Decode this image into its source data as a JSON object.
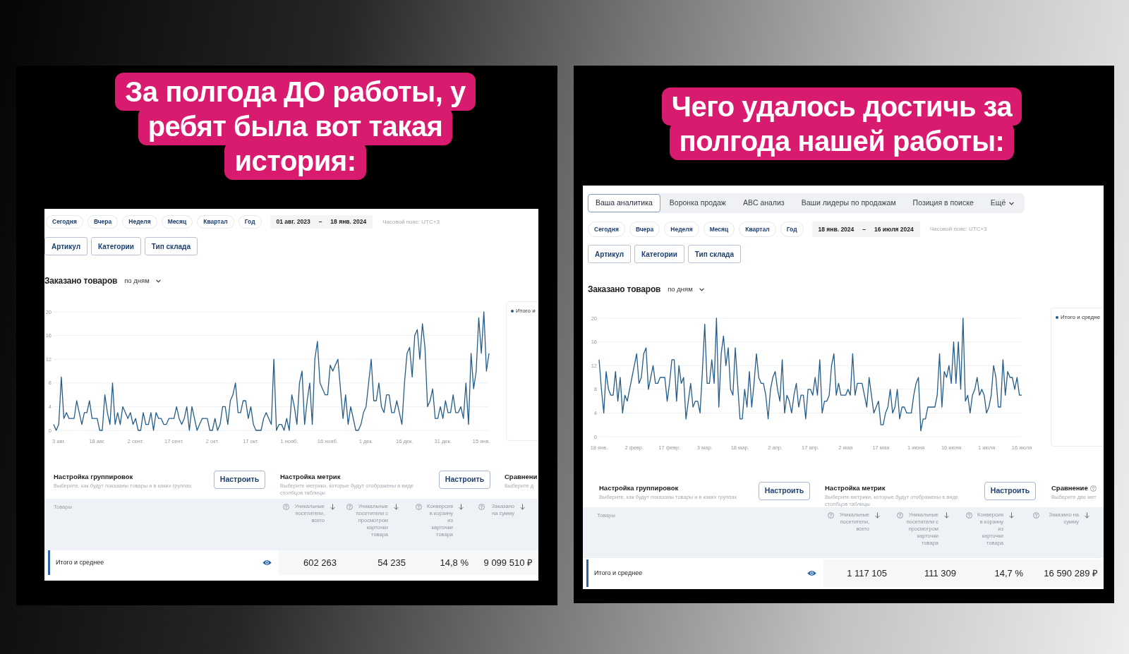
{
  "panels": [
    {
      "headline": "За полгода ДО работы, у ребят была вот такая история:",
      "screenshot": {
        "periods": [
          {
            "label": "Сегодня",
            "selected": false
          },
          {
            "label": "Вчера",
            "selected": false
          },
          {
            "label": "Неделя",
            "selected": false
          },
          {
            "label": "Месяц",
            "selected": false
          },
          {
            "label": "Квартал",
            "selected": false
          },
          {
            "label": "Год",
            "selected": false
          }
        ],
        "date_range": {
          "from": "01 авг. 2023",
          "separator": "–",
          "to": "18 янв. 2024"
        },
        "timezone": "Часовой пояс: UTC+3",
        "filters": [
          "Артикул",
          "Категории",
          "Тип склада"
        ],
        "chart_title": "Заказано товаров",
        "granularity": "по дням",
        "chart_data": {
          "type": "line",
          "categories": [
            null,
            null,
            "3 авг.",
            null,
            null,
            null,
            null,
            null,
            null,
            null,
            null,
            null,
            null,
            null,
            null,
            null,
            null,
            "18 авг.",
            null,
            null,
            null,
            null,
            null,
            null,
            null,
            null,
            null,
            null,
            null,
            null,
            null,
            null,
            "2 сент.",
            null,
            null,
            null,
            null,
            null,
            null,
            null,
            null,
            null,
            null,
            null,
            null,
            null,
            null,
            "17 сент.",
            null,
            null,
            null,
            null,
            null,
            null,
            null,
            null,
            null,
            null,
            null,
            null,
            null,
            null,
            "2 окт.",
            null,
            null,
            null,
            null,
            null,
            null,
            null,
            null,
            null,
            null,
            null,
            null,
            null,
            null,
            "17 окт.",
            null,
            null,
            null,
            null,
            null,
            null,
            null,
            null,
            null,
            null,
            null,
            null,
            null,
            null,
            "1 нояб.",
            null,
            null,
            null,
            null,
            null,
            null,
            null,
            null,
            null,
            null,
            null,
            null,
            null,
            null,
            "16 нояб.",
            null,
            null,
            null,
            null,
            null,
            null,
            null,
            null,
            null,
            null,
            null,
            null,
            null,
            null,
            "1 дек.",
            null,
            null,
            null,
            null,
            null,
            null,
            null,
            null,
            null,
            null,
            null,
            null,
            null,
            null,
            "16 дек.",
            null,
            null,
            null,
            null,
            null,
            null,
            null,
            null,
            null,
            null,
            null,
            null,
            null,
            null,
            "31 дек.",
            null,
            null,
            null,
            null,
            null,
            null,
            null,
            null,
            null,
            null,
            null,
            null,
            null,
            null,
            "15 янв.",
            null,
            null,
            null
          ],
          "series": [
            {
              "name": "Итого и",
              "color": "#255d8a",
              "values": [
                1,
                0,
                1,
                9,
                2,
                3,
                2,
                2,
                2,
                5,
                3,
                1,
                3,
                3,
                5,
                2,
                2,
                2,
                0,
                0,
                6,
                3,
                1,
                8,
                1,
                3,
                1,
                4,
                3,
                2,
                3,
                1,
                2,
                0,
                0,
                3,
                1,
                1,
                3,
                0,
                3,
                2,
                2,
                1,
                1,
                2,
                2,
                2,
                4,
                2,
                1,
                2,
                4,
                0,
                4,
                2,
                0,
                1,
                2,
                2,
                2,
                0,
                0,
                2,
                0,
                1,
                4,
                4,
                1,
                5,
                6,
                8,
                3,
                3,
                5,
                5,
                2,
                4,
                1,
                0,
                0,
                0,
                2,
                3,
                2,
                1,
                12,
                0,
                1,
                1,
                0,
                2,
                0,
                6,
                4,
                1,
                8,
                10,
                1,
                5,
                8,
                1,
                12,
                15,
                8,
                7,
                6,
                6,
                11,
                10,
                11,
                12,
                7,
                2,
                6,
                1,
                4,
                2,
                0,
                0,
                1,
                3,
                4,
                8,
                12,
                5,
                5,
                8,
                4,
                3,
                6,
                6,
                3,
                3,
                5,
                3,
                1,
                8,
                13,
                14,
                9,
                16,
                17,
                12,
                18,
                14,
                4,
                5,
                7,
                2,
                2,
                4,
                2,
                5,
                3,
                3,
                6,
                3,
                3,
                4,
                2,
                8,
                1,
                13,
                7,
                10,
                19,
                13,
                20,
                10,
                13
              ]
            }
          ],
          "ylim": [
            0,
            20
          ],
          "yticks": [
            0,
            4,
            8,
            12,
            16,
            20
          ],
          "grid": true,
          "legend": "right"
        },
        "settings": [
          {
            "title": "Настройка группировок",
            "description": "Выберите, как будут показаны товары и в каких группах",
            "button": "Настроить"
          },
          {
            "title": "Настройка метрик",
            "description": "Выберите метрики, которые будут отображены в виде столбцов таблицы",
            "button": "Настроить"
          },
          {
            "title": "Сравнени",
            "description": "Выберите д"
          }
        ],
        "table": {
          "columns": [
            {
              "kind": "dimension",
              "label": "Товары"
            },
            {
              "kind": "metric",
              "label": "Уникальные посетители, всего"
            },
            {
              "kind": "metric",
              "label": "Уникальные посетители с просмотром карточки товара"
            },
            {
              "kind": "metric",
              "label": "Конверсия в корзину из карточки товара"
            },
            {
              "kind": "metric",
              "label": "Заказано на сумму"
            }
          ],
          "rows": [
            {
              "cells": [
                "Итого и среднее",
                "602 263",
                "54 235",
                "14,8 %",
                "9 099 510 ₽"
              ]
            }
          ]
        }
      }
    },
    {
      "headline": "Чего удалось достичь за полгода нашей работы:",
      "screenshot": {
        "tabs": [
          {
            "label": "Ваша аналитика",
            "kind": "tab",
            "selected": true
          },
          {
            "label": "Воронка продаж",
            "kind": "tab",
            "selected": false
          },
          {
            "label": "ABC анализ",
            "kind": "tab",
            "selected": false
          },
          {
            "label": "Ваши лидеры по продажам",
            "kind": "tab",
            "selected": false
          },
          {
            "label": "Позиция в поиске",
            "kind": "tab",
            "selected": false
          },
          {
            "label": "Ещё",
            "kind": "menu",
            "selected": false
          }
        ],
        "periods": [
          {
            "label": "Сегодня",
            "selected": false
          },
          {
            "label": "Вчера",
            "selected": false
          },
          {
            "label": "Неделя",
            "selected": false
          },
          {
            "label": "Месяц",
            "selected": false
          },
          {
            "label": "Квартал",
            "selected": false
          },
          {
            "label": "Год",
            "selected": false
          }
        ],
        "date_range": {
          "from": "18 янв. 2024",
          "separator": "–",
          "to": "16 июля 2024"
        },
        "timezone": "Часовой пояс: UTC+3",
        "filters": [
          "Артикул",
          "Категории",
          "Тип склада"
        ],
        "chart_title": "Заказано товаров",
        "granularity": "по дням",
        "chart_data": {
          "type": "line",
          "categories": [
            "18 янв.",
            null,
            null,
            null,
            null,
            null,
            null,
            null,
            null,
            null,
            null,
            null,
            null,
            null,
            null,
            "2 февр.",
            null,
            null,
            null,
            null,
            null,
            null,
            null,
            null,
            null,
            null,
            null,
            null,
            null,
            null,
            "17 февр.",
            null,
            null,
            null,
            null,
            null,
            null,
            null,
            null,
            null,
            null,
            null,
            null,
            null,
            null,
            "3 мар.",
            null,
            null,
            null,
            null,
            null,
            null,
            null,
            null,
            null,
            null,
            null,
            null,
            null,
            null,
            "18 мар.",
            null,
            null,
            null,
            null,
            null,
            null,
            null,
            null,
            null,
            null,
            null,
            null,
            null,
            null,
            "2 апр.",
            null,
            null,
            null,
            null,
            null,
            null,
            null,
            null,
            null,
            null,
            null,
            null,
            null,
            null,
            "17 апр.",
            null,
            null,
            null,
            null,
            null,
            null,
            null,
            null,
            null,
            null,
            null,
            null,
            null,
            null,
            "2 мая",
            null,
            null,
            null,
            null,
            null,
            null,
            null,
            null,
            null,
            null,
            null,
            null,
            null,
            null,
            "17 мая",
            null,
            null,
            null,
            null,
            null,
            null,
            null,
            null,
            null,
            null,
            null,
            null,
            null,
            null,
            "1 июня",
            null,
            null,
            null,
            null,
            null,
            null,
            null,
            null,
            null,
            null,
            null,
            null,
            null,
            null,
            "16 июня",
            null,
            null,
            null,
            null,
            null,
            null,
            null,
            null,
            null,
            null,
            null,
            null,
            null,
            null,
            "1 июля",
            null,
            null,
            null,
            null,
            null,
            null,
            null,
            null,
            null,
            null,
            null,
            null,
            null,
            null,
            "16 июля"
          ],
          "series": [
            {
              "name": "Итого и средне",
              "color": "#255d8a",
              "values": [
                13,
                8,
                4,
                11,
                8,
                7,
                7,
                11,
                6,
                10,
                4,
                7,
                6,
                8,
                10,
                12,
                14,
                9,
                10,
                14,
                15,
                8,
                10,
                12,
                9,
                9,
                10,
                10,
                10,
                6,
                9,
                13,
                13,
                6,
                12,
                9,
                10,
                3,
                6,
                9,
                5,
                6,
                6,
                4,
                11,
                19,
                9,
                9,
                13,
                9,
                20,
                5,
                14,
                17,
                12,
                15,
                8,
                7,
                15,
                9,
                3,
                3,
                8,
                5,
                11,
                5,
                9,
                14,
                10,
                9,
                9,
                7,
                3,
                8,
                10,
                11,
                8,
                6,
                13,
                4,
                7,
                6,
                4,
                7,
                9,
                5,
                7,
                7,
                3,
                8,
                8,
                7,
                10,
                7,
                13,
                4,
                6,
                6,
                7,
                12,
                14,
                7,
                9,
                7,
                7,
                7,
                8,
                7,
                14,
                7,
                9,
                9,
                9,
                7,
                5,
                10,
                7,
                4,
                5,
                6,
                2,
                2,
                4,
                5,
                8,
                4,
                5,
                8,
                3,
                5,
                5,
                4,
                4,
                4,
                7,
                9,
                10,
                1,
                3,
                3,
                5,
                5,
                5,
                5,
                7,
                14,
                5,
                11,
                10,
                12,
                9,
                16,
                9,
                16,
                8,
                20,
                6,
                7,
                4,
                7,
                8,
                10,
                7,
                8,
                7,
                4,
                5,
                7,
                12,
                10,
                5,
                5,
                13,
                7,
                11,
                10,
                10,
                8,
                10,
                7,
                7
              ]
            }
          ],
          "ylim": [
            0,
            20
          ],
          "yticks": [
            0,
            4,
            8,
            12,
            16,
            20
          ],
          "grid": true,
          "legend": "right"
        },
        "settings": [
          {
            "title": "Настройка группировок",
            "description": "Выберите, как будут показаны товары и в каких группах",
            "button": "Настроить"
          },
          {
            "title": "Настройка метрик",
            "description": "Выберите метрики, которые будут отображены в виде столбцов таблицы",
            "button": "Настроить"
          },
          {
            "title": "Сравнение",
            "help": true,
            "description": "Выберите две мет"
          }
        ],
        "table": {
          "columns": [
            {
              "kind": "dimension",
              "label": "Товары"
            },
            {
              "kind": "metric",
              "label": "Уникальные посетители, всего"
            },
            {
              "kind": "metric",
              "label": "Уникальные посетители с просмотром карточки товара"
            },
            {
              "kind": "metric",
              "label": "Конверсия в корзину из карточки товара"
            },
            {
              "kind": "metric",
              "label": "Заказано на сумму"
            }
          ],
          "rows": [
            {
              "cells": [
                "Итого и среднее",
                "1 117 105",
                "111 309",
                "14,7 %",
                "16 590 289 ₽"
              ]
            }
          ]
        }
      }
    }
  ]
}
